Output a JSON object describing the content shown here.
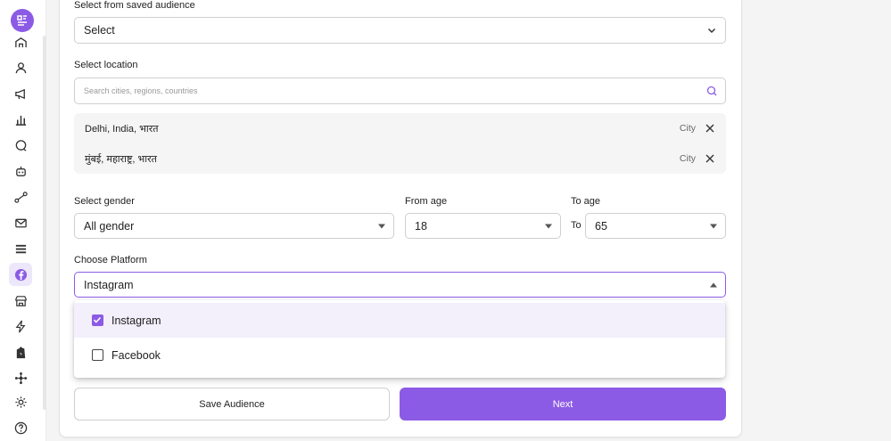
{
  "sidebar": {
    "items": [
      {
        "icon": "home-icon"
      },
      {
        "icon": "user-icon"
      },
      {
        "icon": "megaphone-icon"
      },
      {
        "icon": "bar-chart-icon"
      },
      {
        "icon": "chat-icon"
      },
      {
        "icon": "bot-icon"
      },
      {
        "icon": "workflow-icon"
      },
      {
        "icon": "mail-icon"
      },
      {
        "icon": "list-icon"
      },
      {
        "icon": "facebook-icon"
      },
      {
        "icon": "store-icon"
      },
      {
        "icon": "lightning-icon"
      },
      {
        "icon": "shopify-icon"
      },
      {
        "icon": "network-icon"
      },
      {
        "icon": "gear-icon"
      },
      {
        "icon": "help-icon"
      }
    ],
    "active": "facebook-icon"
  },
  "form": {
    "saved_audience": {
      "label": "Select from saved audience",
      "value": "Select"
    },
    "location": {
      "label": "Select location",
      "placeholder": "Search cities, regions, countries",
      "selected": [
        {
          "name": "Delhi, India, भारत",
          "type": "City"
        },
        {
          "name": "मुंबई, महाराष्ट्र, भारत",
          "type": "City"
        }
      ]
    },
    "gender": {
      "label": "Select gender",
      "value": "All gender"
    },
    "from_age": {
      "label": "From age",
      "value": "18"
    },
    "to_age": {
      "label": "To age",
      "prefix": "To",
      "value": "65"
    },
    "platform": {
      "label": "Choose Platform",
      "value": "Instagram",
      "options": [
        {
          "label": "Instagram",
          "checked": true
        },
        {
          "label": "Facebook",
          "checked": false
        }
      ]
    },
    "buttons": {
      "save": "Save Audience",
      "next": "Next"
    }
  },
  "colors": {
    "accent": "#8c5be5",
    "accent_light": "#f3effb"
  }
}
